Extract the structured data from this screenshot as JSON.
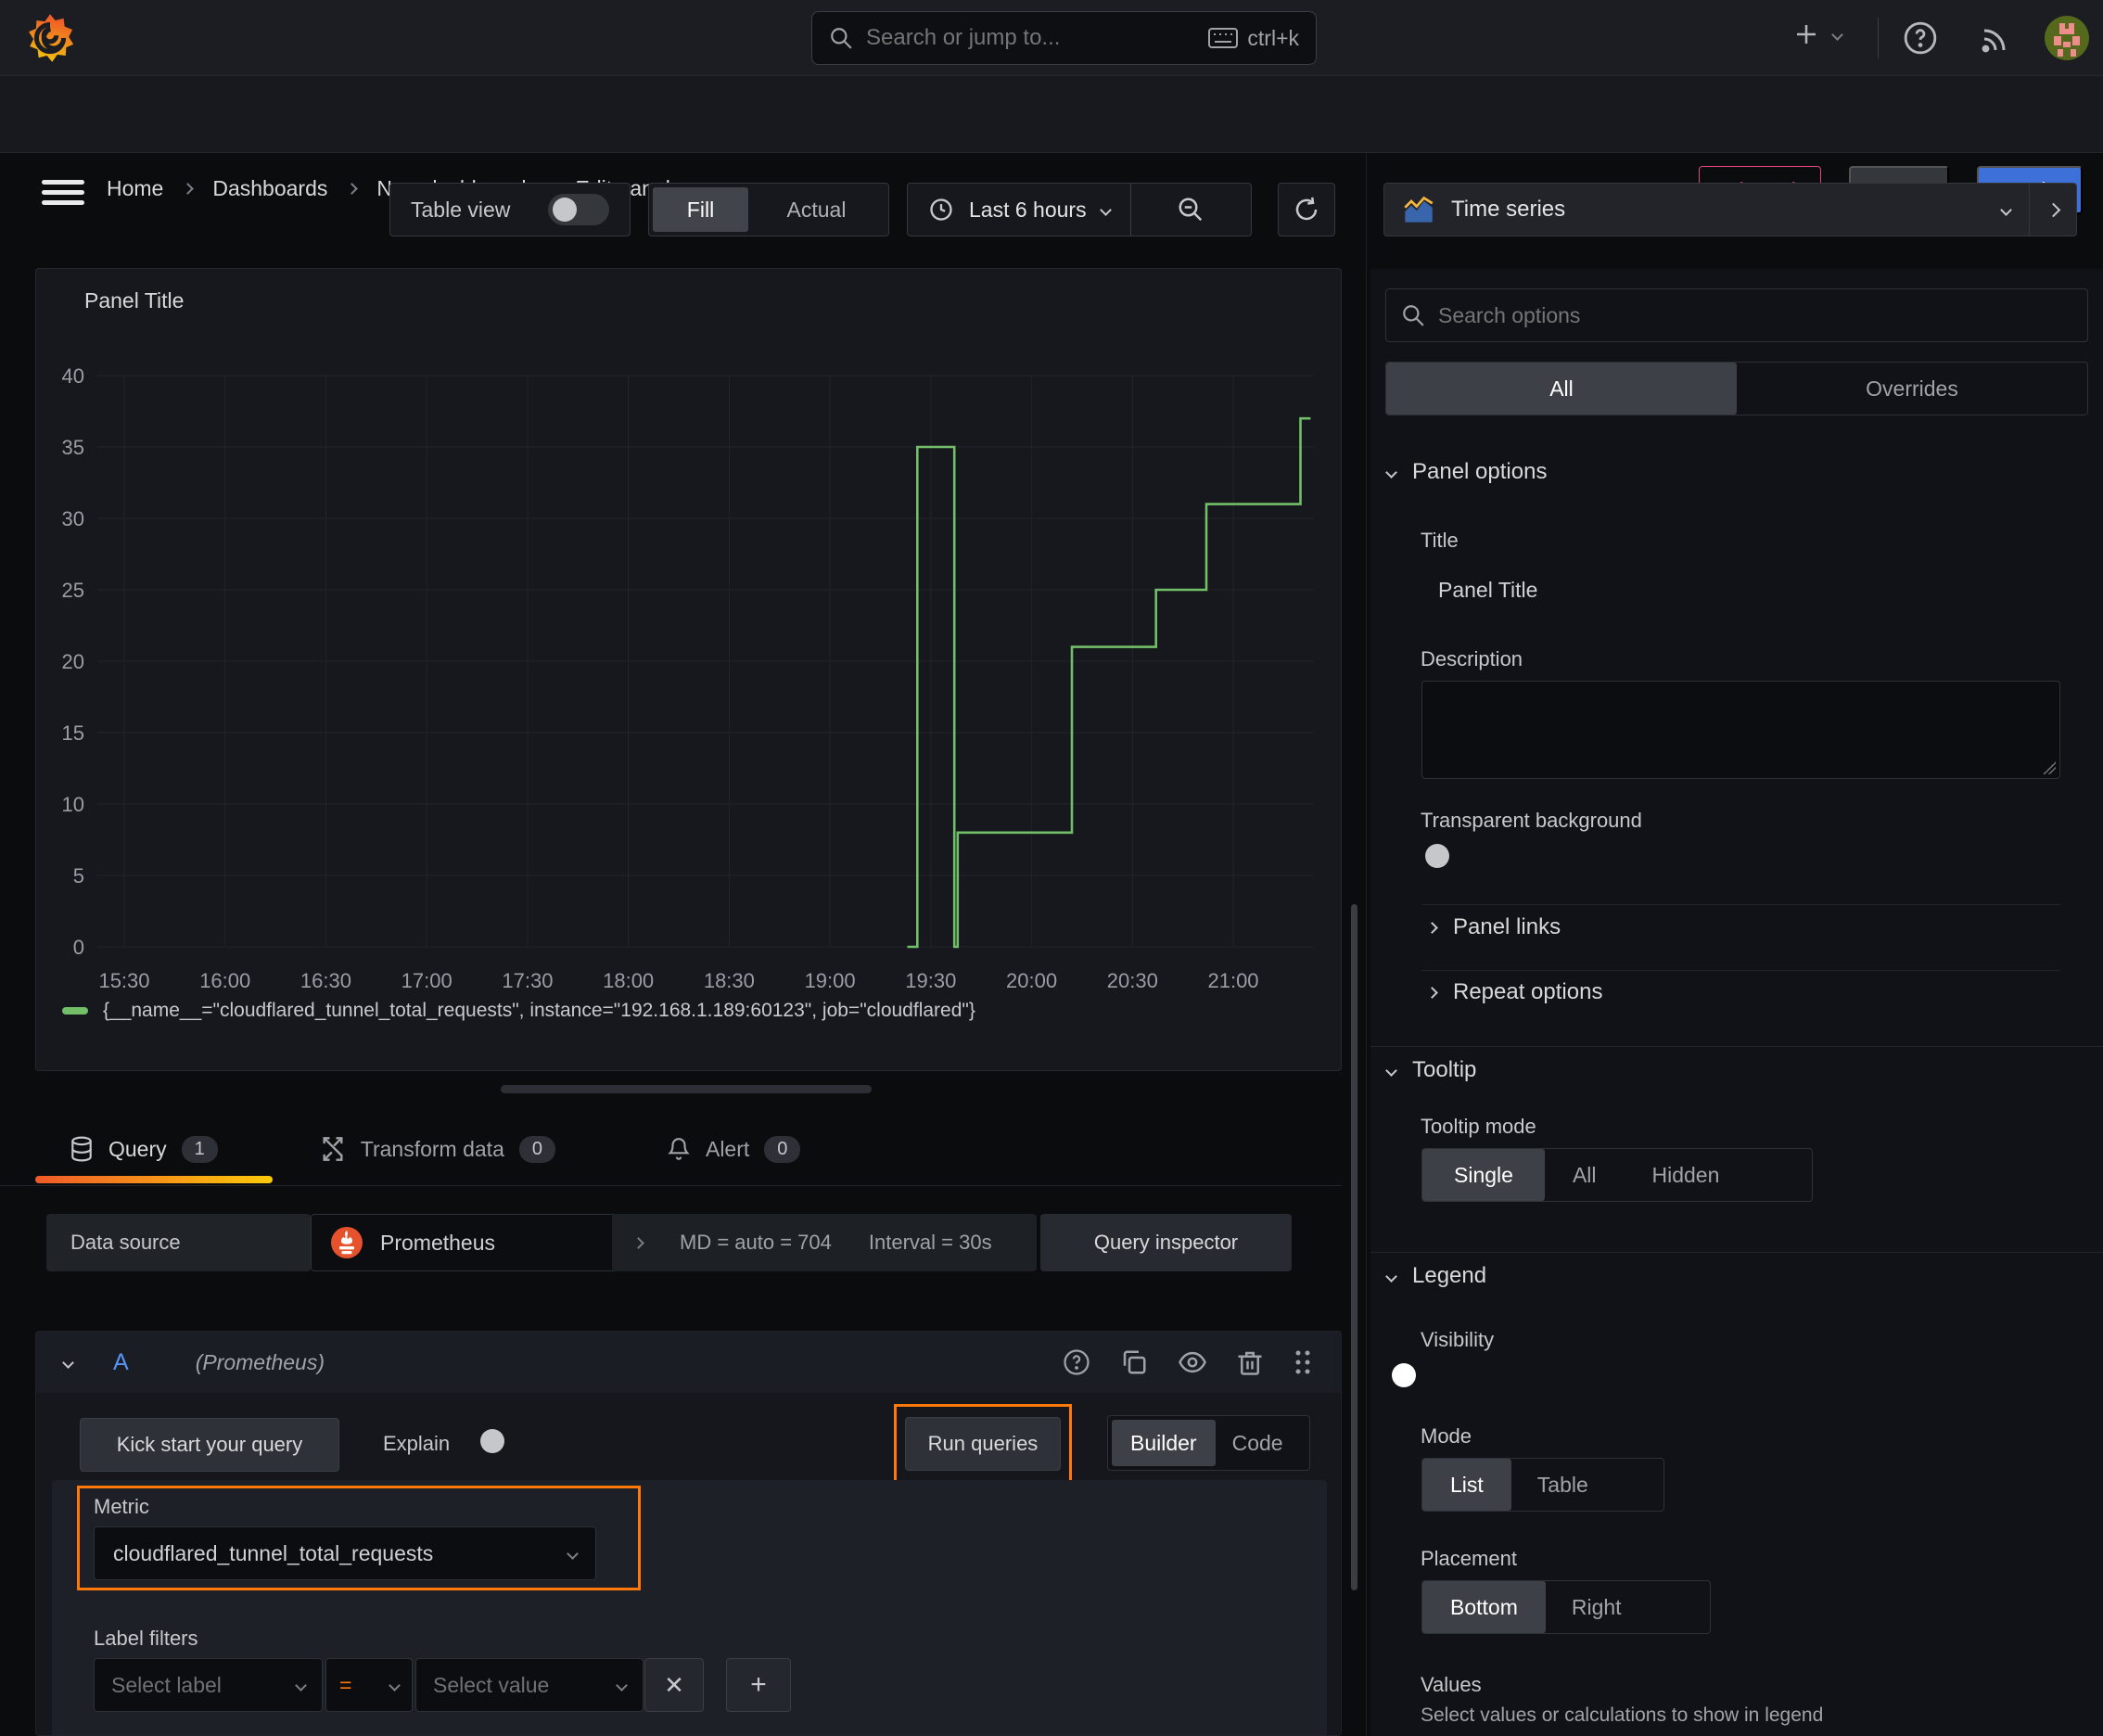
{
  "topbar": {
    "search_placeholder": "Search or jump to...",
    "shortcut": "ctrl+k"
  },
  "breadcrumb": {
    "items": [
      "Home",
      "Dashboards",
      "New dashboard",
      "Edit panel"
    ]
  },
  "actions": {
    "discard": "Discard",
    "save": "Save",
    "apply": "Apply"
  },
  "toolbar": {
    "table_view": "Table view",
    "fill": "Fill",
    "actual": "Actual",
    "time_range": "Last 6 hours"
  },
  "viz_picker": {
    "label": "Time series"
  },
  "options": {
    "search_placeholder": "Search options",
    "tab_all": "All",
    "tab_overrides": "Overrides",
    "panel_options": {
      "header": "Panel options",
      "title_label": "Title",
      "title_value": "Panel Title",
      "description_label": "Description",
      "transparent_label": "Transparent background"
    },
    "panel_links": "Panel links",
    "repeat_options": "Repeat options",
    "tooltip": {
      "header": "Tooltip",
      "mode_label": "Tooltip mode",
      "modes": [
        "Single",
        "All",
        "Hidden"
      ],
      "selected": "Single"
    },
    "legend": {
      "header": "Legend",
      "visibility_label": "Visibility",
      "mode_label": "Mode",
      "modes": [
        "List",
        "Table"
      ],
      "selected_mode": "List",
      "placement_label": "Placement",
      "placements": [
        "Bottom",
        "Right"
      ],
      "selected_placement": "Bottom",
      "values_label": "Values",
      "values_help": "Select values or calculations to show in legend"
    }
  },
  "panel": {
    "title": "Panel Title"
  },
  "chart_data": {
    "type": "line",
    "style": "step",
    "title": "Panel Title",
    "xlabel": "",
    "ylabel": "",
    "ylim": [
      0,
      40
    ],
    "yticks": [
      0,
      5,
      10,
      15,
      20,
      25,
      30,
      35,
      40
    ],
    "xticks": [
      "15:30",
      "16:00",
      "16:30",
      "17:00",
      "17:30",
      "18:00",
      "18:30",
      "19:00",
      "19:30",
      "20:00",
      "20:30",
      "21:00"
    ],
    "x_domain": [
      "15:22",
      "21:24"
    ],
    "grid": true,
    "legend_position": "bottom",
    "series": [
      {
        "name": "{__name__=\"cloudflared_tunnel_total_requests\", instance=\"192.168.1.189:60123\", job=\"cloudflared\"}",
        "color": "#73bf69",
        "points": [
          [
            "19:23",
            0
          ],
          [
            "19:26",
            0
          ],
          [
            "19:26",
            35
          ],
          [
            "19:37",
            35
          ],
          [
            "19:37",
            0
          ],
          [
            "19:38",
            0
          ],
          [
            "19:38",
            8
          ],
          [
            "20:12",
            8
          ],
          [
            "20:12",
            21
          ],
          [
            "20:37",
            21
          ],
          [
            "20:37",
            25
          ],
          [
            "20:52",
            25
          ],
          [
            "20:52",
            31
          ],
          [
            "21:20",
            31
          ],
          [
            "21:20",
            37
          ],
          [
            "21:23",
            37
          ]
        ]
      }
    ]
  },
  "query_section": {
    "tabs": [
      {
        "label": "Query",
        "count": "1"
      },
      {
        "label": "Transform data",
        "count": "0"
      },
      {
        "label": "Alert",
        "count": "0"
      }
    ],
    "datasource_label": "Data source",
    "datasource_value": "Prometheus",
    "md_text": "MD = auto = 704",
    "interval_text": "Interval = 30s",
    "inspector_label": "Query inspector",
    "query_ref": "A",
    "query_ds": "(Prometheus)",
    "kickstart_label": "Kick start your query",
    "explain_label": "Explain",
    "run_label": "Run queries",
    "builder_label": "Builder",
    "code_label": "Code",
    "metric_label": "Metric",
    "metric_value": "cloudflared_tunnel_total_requests",
    "label_filters_label": "Label filters",
    "select_label_placeholder": "Select label",
    "operator": "=",
    "select_value_placeholder": "Select value"
  }
}
